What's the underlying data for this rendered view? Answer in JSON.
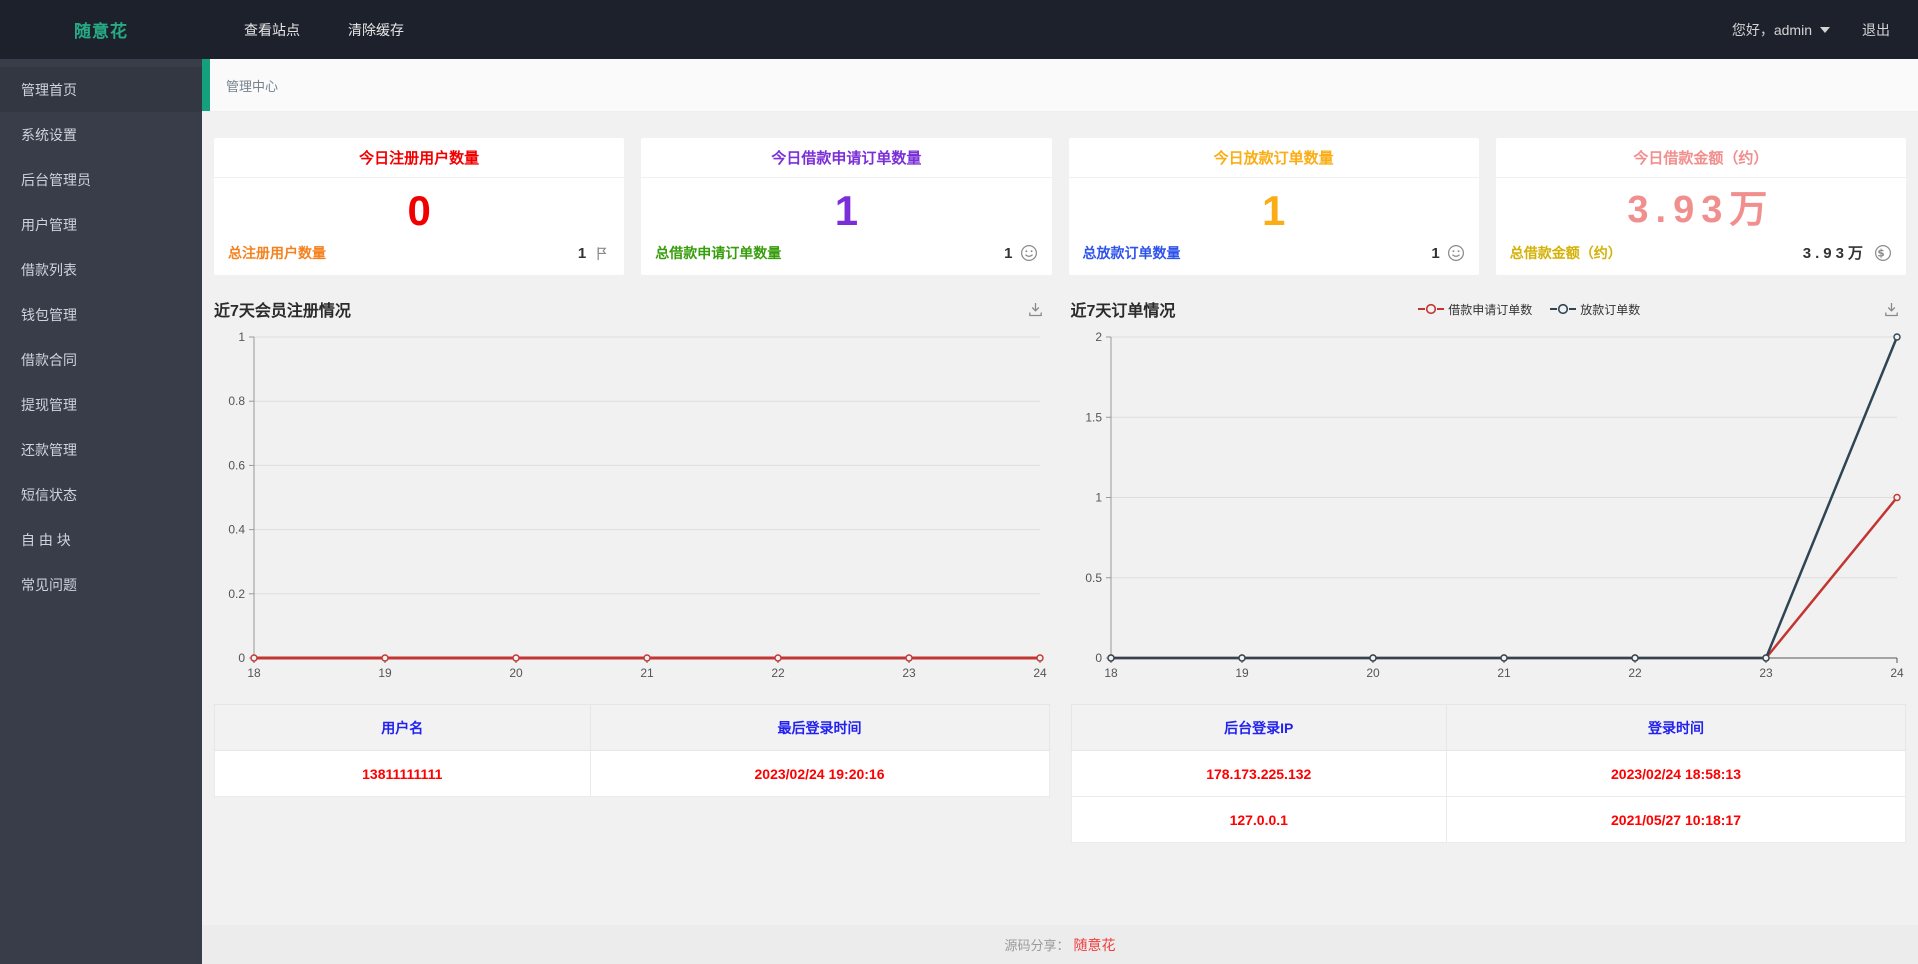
{
  "topbar": {
    "brand": "随意花",
    "nav": [
      {
        "label": "查看站点"
      },
      {
        "label": "清除缓存"
      }
    ],
    "greeting": "您好，admin",
    "logout_label": "退出"
  },
  "sidebar": {
    "items": [
      {
        "label": "管理首页",
        "active": true
      },
      {
        "label": "系统设置"
      },
      {
        "label": "后台管理员"
      },
      {
        "label": "用户管理"
      },
      {
        "label": "借款列表"
      },
      {
        "label": "钱包管理"
      },
      {
        "label": "借款合同"
      },
      {
        "label": "提现管理"
      },
      {
        "label": "还款管理"
      },
      {
        "label": "短信状态"
      },
      {
        "label": "自 由 块"
      },
      {
        "label": "常见问题"
      }
    ]
  },
  "breadcrumb": "管理中心",
  "colors": {
    "accent_teal": "#14a07c",
    "card1_accent": "#f20000",
    "card2_accent": "#7b2fd8",
    "card3_accent": "#faad14",
    "card4_accent": "#f18e8e",
    "card1_footer_label": "#f58220",
    "card2_footer_label": "#389e0d",
    "card3_footer_label": "#2f54eb",
    "card4_footer_label": "#d4b106",
    "table_header_text": "#2222f0",
    "table_cell_text": "#fe0000",
    "series_red": "#c23531",
    "series_dark": "#2f4554"
  },
  "stat_cards": [
    {
      "title": "今日注册用户数量",
      "value": "0",
      "footer_label": "总注册用户数量",
      "footer_value": "1",
      "footer_icon": "flag-icon"
    },
    {
      "title": "今日借款申请订单数量",
      "value": "1",
      "footer_label": "总借款申请订单数量",
      "footer_value": "1",
      "footer_icon": "smiley-icon"
    },
    {
      "title": "今日放款订单数量",
      "value": "1",
      "footer_label": "总放款订单数量",
      "footer_value": "1",
      "footer_icon": "smiley-icon"
    },
    {
      "title": "今日借款金额（约）",
      "value": "3.93万",
      "footer_label": "总借款金额（约）",
      "footer_value": "3.93万",
      "footer_icon": "dollar-icon"
    }
  ],
  "chart_data": [
    {
      "type": "line",
      "title": "近7天会员注册情况",
      "x": [
        "18",
        "19",
        "20",
        "21",
        "22",
        "23",
        "24"
      ],
      "series": [
        {
          "name": "",
          "color": "#c23531",
          "width": 3,
          "values": [
            0,
            0,
            0,
            0,
            0,
            0,
            0
          ]
        }
      ],
      "ylim": [
        0,
        1
      ],
      "yticks": [
        0,
        0.2,
        0.4,
        0.6,
        0.8,
        1
      ],
      "grid": true,
      "legend": []
    },
    {
      "type": "line",
      "title": "近7天订单情况",
      "x": [
        "18",
        "19",
        "20",
        "21",
        "22",
        "23",
        "24"
      ],
      "series": [
        {
          "name": "借款申请订单数",
          "color": "#c23531",
          "width": 2.5,
          "values": [
            0,
            0,
            0,
            0,
            0,
            0,
            1
          ]
        },
        {
          "name": "放款订单数",
          "color": "#2f4554",
          "width": 2.5,
          "values": [
            0,
            0,
            0,
            0,
            0,
            0,
            2
          ]
        }
      ],
      "ylim": [
        0,
        2
      ],
      "yticks": [
        0,
        0.5,
        1,
        1.5,
        2
      ],
      "grid": true,
      "legend_position": "top-center"
    }
  ],
  "tables": [
    {
      "headers": [
        "用户名",
        "最后登录时间"
      ],
      "rows": [
        [
          "13811111111",
          "2023/02/24 19:20:16"
        ]
      ]
    },
    {
      "headers": [
        "后台登录IP",
        "登录时间"
      ],
      "rows": [
        [
          "178.173.225.132",
          "2023/02/24 18:58:13"
        ],
        [
          "127.0.0.1",
          "2021/05/27 10:18:17"
        ]
      ]
    }
  ],
  "footer": {
    "prefix": "源码分享：",
    "link_label": "随意花"
  }
}
